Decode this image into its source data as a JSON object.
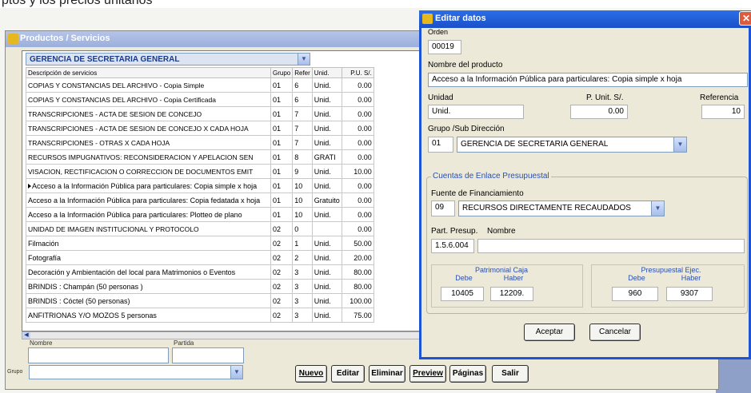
{
  "top_strip_text": "ptos y los precios unitarios",
  "main_window": {
    "title": "Productos / Servicios",
    "group_filter": "GERENCIA DE SECRETARIA GENERAL",
    "columns": [
      "Descripción de servicios",
      "Grupo",
      "Refer",
      "Unid.",
      "P.U. S/."
    ],
    "rows": [
      {
        "desc": "COPIAS Y CONSTANCIAS DEL ARCHIVO - Copia Simple",
        "grupo": "01",
        "refer": "6",
        "unid": "Unid.",
        "pu": "0.00",
        "caps": true
      },
      {
        "desc": "COPIAS Y CONSTANCIAS DEL ARCHIVO - Copia Certificada",
        "grupo": "01",
        "refer": "6",
        "unid": "Unid.",
        "pu": "0.00",
        "caps": true
      },
      {
        "desc": "TRANSCRIPCIONES - ACTA DE SESION DE CONCEJO",
        "grupo": "01",
        "refer": "7",
        "unid": "Unid.",
        "pu": "0.00",
        "caps": true
      },
      {
        "desc": "TRANSCRIPCIONES - ACTA DE SESION DE CONCEJO X CADA HOJA",
        "grupo": "01",
        "refer": "7",
        "unid": "Unid.",
        "pu": "0.00",
        "caps": true
      },
      {
        "desc": "TRANSCRIPCIONES - OTRAS X CADA HOJA",
        "grupo": "01",
        "refer": "7",
        "unid": "Unid.",
        "pu": "0.00",
        "caps": true
      },
      {
        "desc": "RECURSOS IMPUGNATIVOS: RECONSIDERACION Y APELACION SEN",
        "grupo": "01",
        "refer": "8",
        "unid": "GRATI",
        "pu": "0.00",
        "caps": true
      },
      {
        "desc": "VISACION, RECTIFICACION O CORRECCION DE  DOCUMENTOS EMIT",
        "grupo": "01",
        "refer": "9",
        "unid": "Unid.",
        "pu": "10.00",
        "caps": true
      },
      {
        "desc": "Acceso a la Información Pública para particulares: Copia simple x hoja",
        "grupo": "01",
        "refer": "10",
        "unid": "Unid.",
        "pu": "0.00",
        "caps": false,
        "current": true
      },
      {
        "desc": "Acceso a la Información Pública para particulares: Copia fedatada x hoja",
        "grupo": "01",
        "refer": "10",
        "unid": "Gratuito",
        "pu": "0.00",
        "caps": false
      },
      {
        "desc": "Acceso a la Información Pública para particulares: Plotteo de plano",
        "grupo": "01",
        "refer": "10",
        "unid": "Unid.",
        "pu": "0.00",
        "caps": false
      },
      {
        "desc": "UNIDAD DE IMAGEN INSTITUCIONAL Y PROTOCOLO",
        "grupo": "02",
        "refer": "0",
        "unid": "",
        "pu": "0.00",
        "caps": true
      },
      {
        "desc": "Filmación",
        "grupo": "02",
        "refer": "1",
        "unid": "Unid.",
        "pu": "50.00",
        "caps": false
      },
      {
        "desc": "Fotografía",
        "grupo": "02",
        "refer": "2",
        "unid": "Unid.",
        "pu": "20.00",
        "caps": false
      },
      {
        "desc": "Decoración y Ambientación del local para Matrimonios o Eventos",
        "grupo": "02",
        "refer": "3",
        "unid": "Unid.",
        "pu": "80.00",
        "caps": false
      },
      {
        "desc": "BRINDIS : Champán (50 personas )",
        "grupo": "02",
        "refer": "3",
        "unid": "Unid.",
        "pu": "80.00",
        "caps": false
      },
      {
        "desc": "BRINDIS : Cóctel (50 personas)",
        "grupo": "02",
        "refer": "3",
        "unid": "Unid.",
        "pu": "100.00",
        "caps": false
      },
      {
        "desc": "ANFITRIONAS Y/O MOZOS 5 personas",
        "grupo": "02",
        "refer": "3",
        "unid": "Unid.",
        "pu": "75.00",
        "caps": false
      }
    ],
    "bottom_labels": {
      "nombre": "Nombre",
      "partida": "Partida",
      "grupo": "Grupo"
    },
    "buttons": {
      "nuevo": "Nuevo",
      "editar": "Editar",
      "eliminar": "Eliminar",
      "preview": "Preview",
      "paginas": "Páginas",
      "salir": "Salir"
    }
  },
  "dialog": {
    "title": "Editar datos",
    "orden_label": "Orden",
    "orden": "00019",
    "nombre_label": "Nombre del producto",
    "nombre": "Acceso a la Información Pública para particulares: Copia simple x hoja",
    "unidad_label": "Unidad",
    "unidad": "Unid.",
    "pu_label": "P. Unit. S/.",
    "pu": "0.00",
    "referencia_label": "Referencia",
    "referencia": "10",
    "grupo_label": "Grupo /Sub Dirección",
    "grupo_code": "01",
    "grupo_name": "GERENCIA DE SECRETARIA GENERAL",
    "cuentas_label": "Cuentas de Enlace Presupuestal",
    "fuente_label": "Fuente de Financiamiento",
    "fuente_code": "09",
    "fuente_name": "RECURSOS DIRECTAMENTE RECAUDADOS",
    "part_label": "Part. Presup.",
    "nombre2_label": "Nombre",
    "part_value": "1.5.6.004",
    "patrimonial_label": "Patrimonial Caja",
    "presupuestal_label": "Presupuestal Ejec.",
    "debe_label": "Debe",
    "haber_label": "Haber",
    "pat_debe": "10405",
    "pat_haber": "12209.",
    "pre_debe": "960",
    "pre_haber": "9307",
    "aceptar": "Aceptar",
    "cancelar": "Cancelar"
  }
}
